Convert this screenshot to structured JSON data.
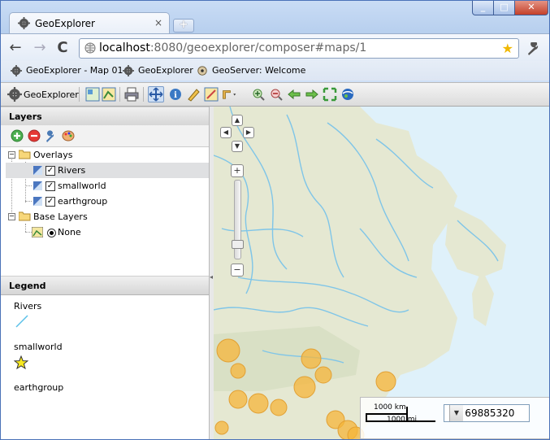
{
  "browser": {
    "tab_title": "GeoExplorer",
    "tab_close": "×",
    "new_tab": "+",
    "url_host": "localhost",
    "url_rest": ":8080/geoexplorer/composer#maps/1",
    "back": "←",
    "forward": "→",
    "reload": "C",
    "star": "★",
    "window_min": "_",
    "window_max": "□",
    "window_close": "✕"
  },
  "bookmarks": [
    {
      "label": "GeoExplorer - Map 01",
      "icon": "gear-icon"
    },
    {
      "label": "GeoExplorer",
      "icon": "gear-icon"
    },
    {
      "label": "GeoServer: Welcome",
      "icon": "geoserver-icon"
    }
  ],
  "toolbar": {
    "app_label": "GeoExplorer",
    "tools": [
      "layout-icon",
      "export-map-icon",
      "print-icon",
      "pan-icon",
      "info-icon",
      "measure-icon",
      "query-icon",
      "measure-dropdown-icon",
      "zoom-in-icon",
      "zoom-out-icon",
      "back-icon",
      "forward-icon",
      "zoom-extent-icon",
      "google-earth-icon"
    ]
  },
  "layers": {
    "header": "Layers",
    "overlays_label": "Overlays",
    "items": [
      "Rivers",
      "smallworld",
      "earthgroup"
    ],
    "base_label": "Base Layers",
    "base_items": [
      "None"
    ]
  },
  "legend": {
    "header": "Legend",
    "entries": [
      "Rivers",
      "smallworld",
      "earthgroup"
    ]
  },
  "map": {
    "scale_km": "1000 km",
    "scale_mi": "1000 mi",
    "scale_value": "1 : 69885320",
    "colors": {
      "water": "#dff1fa",
      "land": "#e4e8d2",
      "river": "#7fc5e8",
      "polygon": "#f5b63a"
    }
  }
}
